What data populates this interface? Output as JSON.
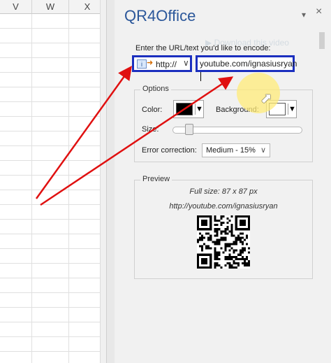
{
  "sheet": {
    "columns": [
      "V",
      "W",
      "X"
    ]
  },
  "pane": {
    "title": "QR4Office",
    "pin_icon": "pin-icon",
    "close_icon": "close-icon",
    "download_overlay": "Download this video",
    "prompt": "Enter the URL/text you'd like to encode:",
    "protocol": {
      "value": "http://",
      "icon": "link-icon"
    },
    "url_value": "youtube.com/ignasiusryan",
    "options": {
      "legend": "Options",
      "color_label": "Color:",
      "color_value": "#000000",
      "background_label": "Background:",
      "background_value": "#ffffff",
      "size_label": "Size:",
      "error_label": "Error correction:",
      "error_value": "Medium - 15%"
    },
    "preview": {
      "legend": "Preview",
      "full_size": "Full size: 87 x 87 px",
      "encoded_url": "http://youtube.com/ignasiusryan"
    }
  },
  "colors": {
    "title": "#2b579a",
    "annotation_blue": "#1b2fbf",
    "annotation_red": "#e01010",
    "highlight": "#ffeb78"
  }
}
